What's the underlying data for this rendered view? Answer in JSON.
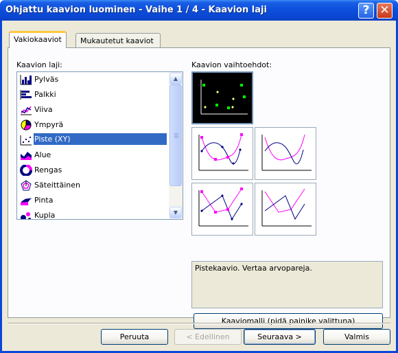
{
  "window": {
    "title": "Ohjattu kaavion luominen - Vaihe 1 / 4 - Kaavion laji",
    "help_label": "?",
    "close_label": "✕"
  },
  "tabs": [
    {
      "label": "Vakiokaaviot",
      "active": true
    },
    {
      "label": "Mukautetut kaaviot",
      "active": false
    }
  ],
  "chart_type_label": "Kaavion laji:",
  "chart_types": [
    {
      "label": "Pylväs",
      "icon": "column-chart-icon"
    },
    {
      "label": "Palkki",
      "icon": "bar-chart-icon"
    },
    {
      "label": "Viiva",
      "icon": "line-chart-icon"
    },
    {
      "label": "Ympyrä",
      "icon": "pie-chart-icon"
    },
    {
      "label": "Piste (XY)",
      "icon": "xy-scatter-icon",
      "selected": true
    },
    {
      "label": "Alue",
      "icon": "area-chart-icon"
    },
    {
      "label": "Rengas",
      "icon": "doughnut-chart-icon"
    },
    {
      "label": "Säteittäinen",
      "icon": "radar-chart-icon"
    },
    {
      "label": "Pinta",
      "icon": "surface-chart-icon"
    },
    {
      "label": "Kupla",
      "icon": "bubble-chart-icon"
    }
  ],
  "subtype_label": "Kaavion vaihtoehdot:",
  "subtypes": [
    {
      "name": "scatter-markers",
      "selected": true
    },
    {
      "name": "scatter-smooth-lines-markers",
      "selected": false
    },
    {
      "name": "scatter-smooth-lines",
      "selected": false
    },
    {
      "name": "scatter-straight-lines-markers",
      "selected": false
    },
    {
      "name": "scatter-straight-lines",
      "selected": false
    }
  ],
  "description": "Pistekaavio. Vertaa arvopareja.",
  "preview_button": "Kaaviomalli (pidä painike valittuna)",
  "buttons": {
    "cancel": "Peruuta",
    "back": "< Edellinen",
    "next": "Seuraava >",
    "finish": "Valmis"
  },
  "colors": {
    "titlebar": "#0a46d8",
    "selection": "#316ac5",
    "dialog_bg": "#ece9d8",
    "series_magenta": "#ff00ff",
    "series_navy": "#000080",
    "marker_green": "#00ff00",
    "marker_yellow": "#ffff80"
  }
}
